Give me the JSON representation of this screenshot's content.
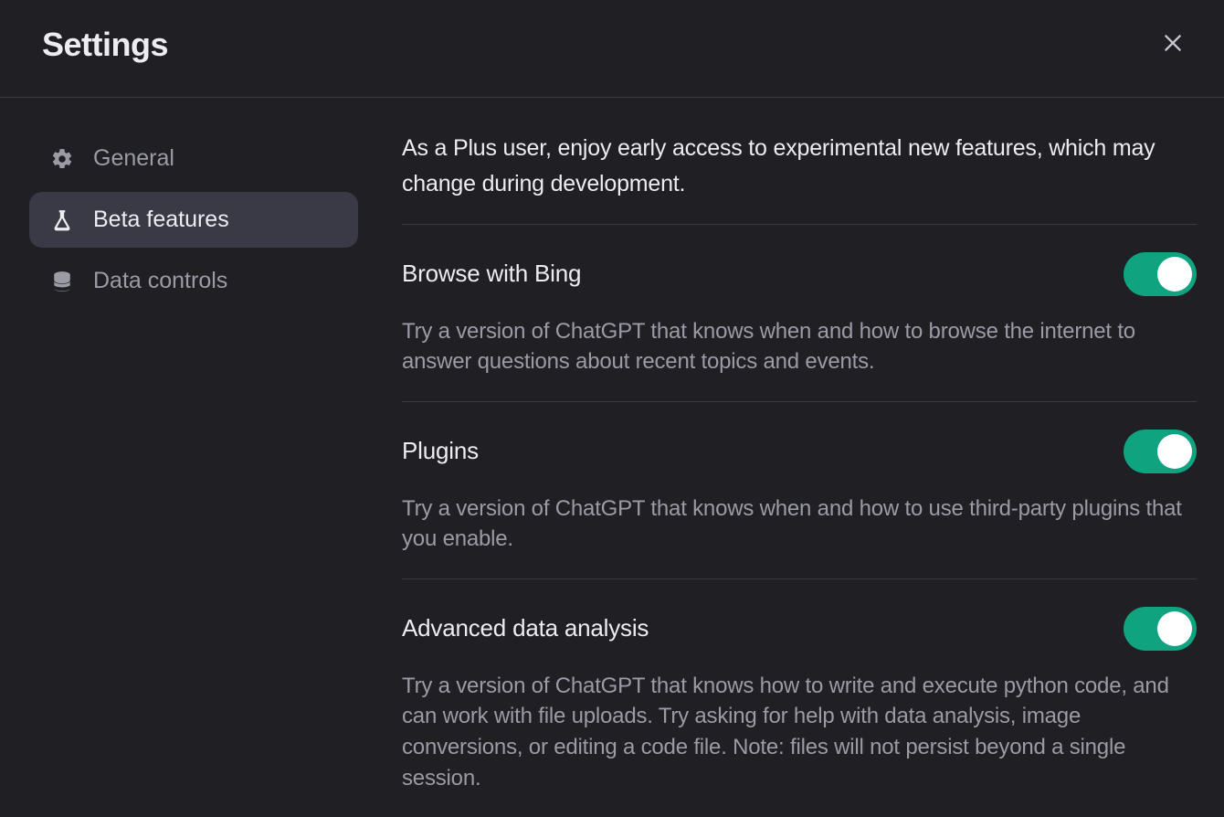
{
  "header": {
    "title": "Settings"
  },
  "sidebar": {
    "items": [
      {
        "label": "General",
        "icon": "gear-icon",
        "active": false
      },
      {
        "label": "Beta features",
        "icon": "beaker-icon",
        "active": true
      },
      {
        "label": "Data controls",
        "icon": "database-icon",
        "active": false
      }
    ]
  },
  "main": {
    "intro": "As a Plus user, enjoy early access to experimental new features, which may change during development.",
    "features": [
      {
        "title": "Browse with Bing",
        "description": "Try a version of ChatGPT that knows when and how to browse the internet to answer questions about recent topics and events.",
        "enabled": true
      },
      {
        "title": "Plugins",
        "description": "Try a version of ChatGPT that knows when and how to use third-party plugins that you enable.",
        "enabled": true
      },
      {
        "title": "Advanced data analysis",
        "description": "Try a version of ChatGPT that knows how to write and execute python code, and can work with file uploads. Try asking for help with data analysis, image conversions, or editing a code file. Note: files will not persist beyond a single session.",
        "enabled": true
      }
    ]
  },
  "colors": {
    "accent": "#10a37f",
    "bg": "#1f1f24",
    "active_bg": "#3a3a46",
    "text": "#ececf1",
    "muted": "#9b9ba6"
  }
}
